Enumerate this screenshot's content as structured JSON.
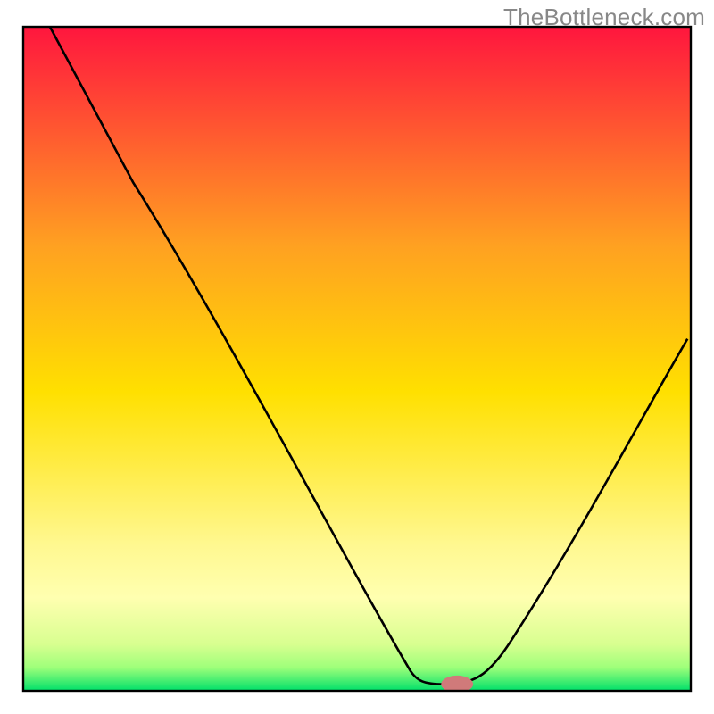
{
  "watermark": "TheBottleneck.com",
  "chart_data": {
    "type": "line",
    "title": "",
    "xlabel": "",
    "ylabel": "",
    "xlim": [
      0,
      100
    ],
    "ylim": [
      0,
      100
    ],
    "gradient_stops": [
      {
        "offset": 0.0,
        "color": "#ff163e"
      },
      {
        "offset": 0.33,
        "color": "#ffa121"
      },
      {
        "offset": 0.55,
        "color": "#ffe000"
      },
      {
        "offset": 0.78,
        "color": "#fff890"
      },
      {
        "offset": 0.86,
        "color": "#ffffb0"
      },
      {
        "offset": 0.93,
        "color": "#d8ff90"
      },
      {
        "offset": 0.965,
        "color": "#9eff7a"
      },
      {
        "offset": 1.0,
        "color": "#00e06a"
      }
    ],
    "series": [
      {
        "name": "bottleneck-curve",
        "segments": [
          {
            "op": "M",
            "x": 4,
            "y": 100
          },
          {
            "op": "L",
            "x": 16.5,
            "y": 76.5
          },
          {
            "op": "C",
            "x1": 30,
            "y1": 55,
            "x2": 48,
            "y2": 20,
            "x": 58,
            "y": 3
          },
          {
            "op": "C",
            "x1": 59,
            "y1": 1.5,
            "x2": 60,
            "y2": 1.0,
            "x": 63,
            "y": 1.0
          },
          {
            "op": "C",
            "x1": 68,
            "y1": 1.0,
            "x2": 70,
            "y2": 2.5,
            "x": 74,
            "y": 9
          },
          {
            "op": "C",
            "x1": 83,
            "y1": 23,
            "x2": 92,
            "y2": 40,
            "x": 99.5,
            "y": 53
          }
        ]
      }
    ],
    "marker": {
      "x": 65,
      "y": 1.0,
      "rx": 2.4,
      "ry": 1.3,
      "color": "#d07a7a"
    },
    "axes": {
      "border_color": "#000000",
      "border_width": 2.4
    }
  }
}
